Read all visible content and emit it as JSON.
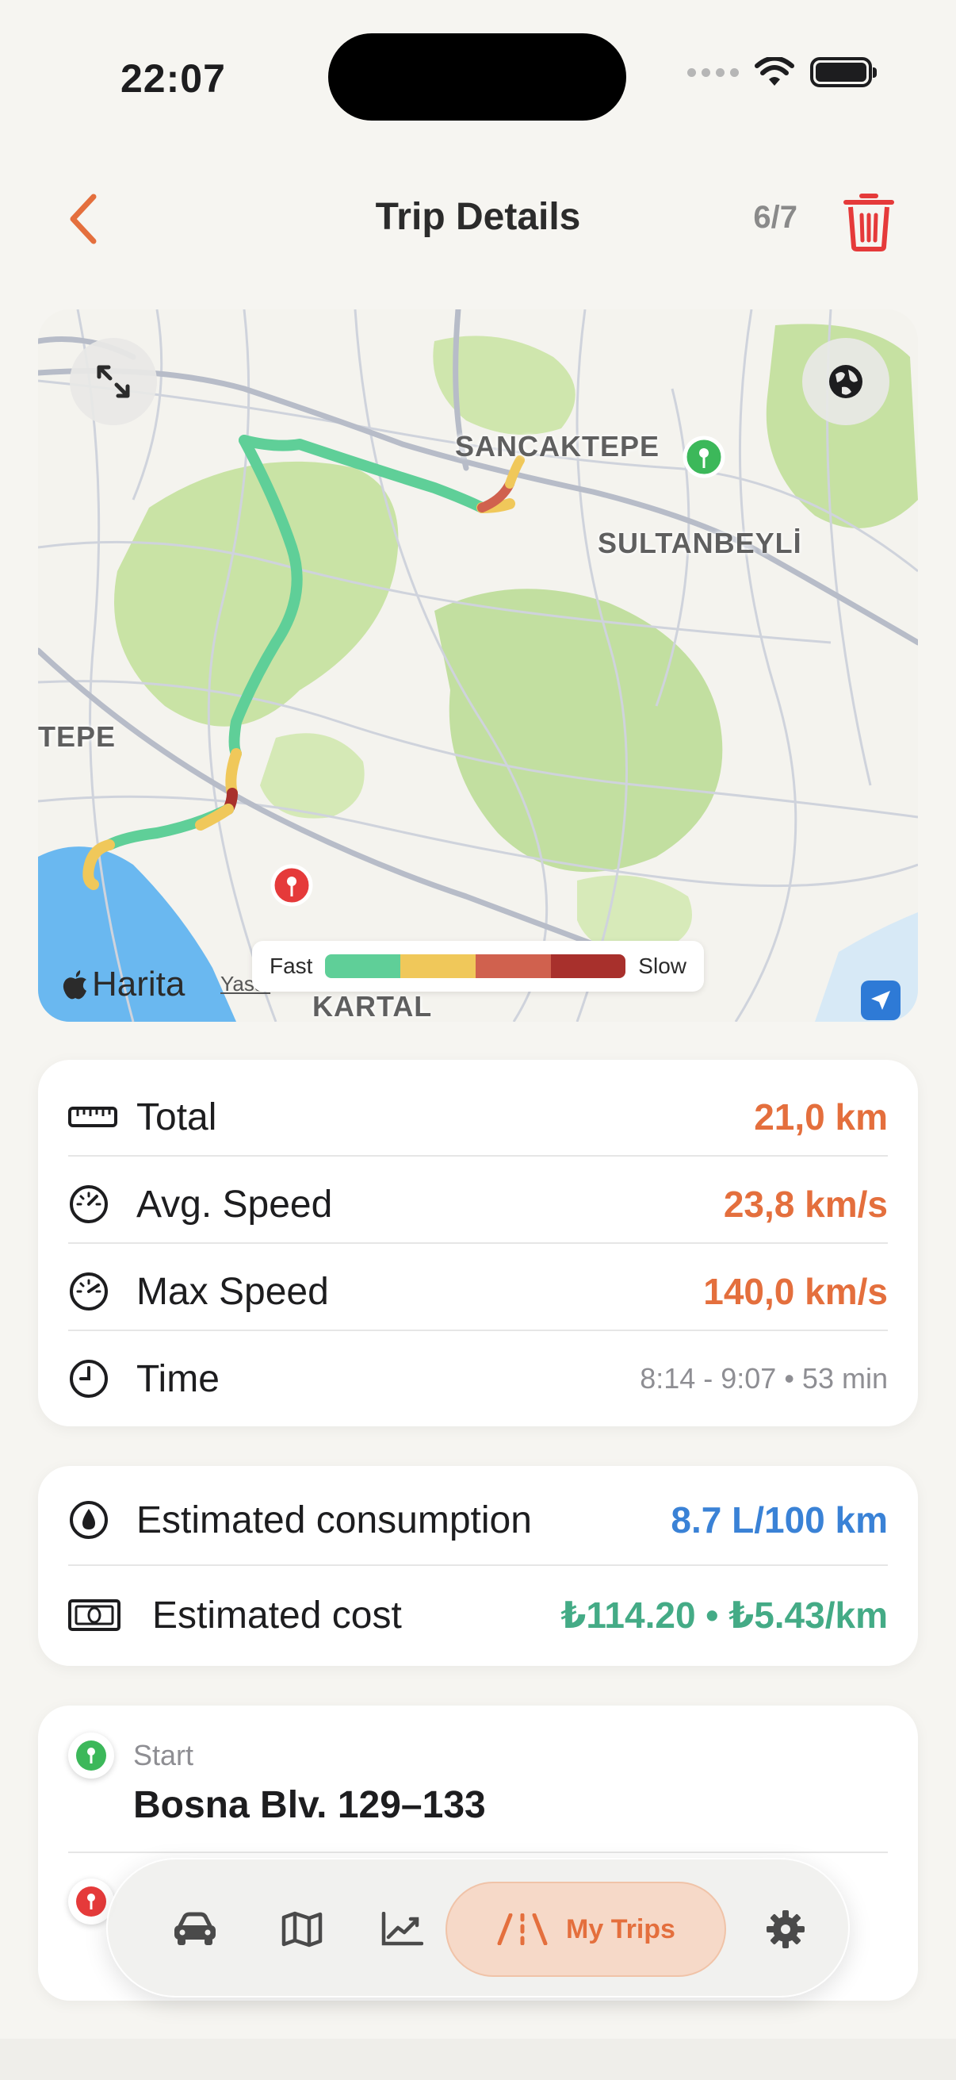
{
  "status_bar": {
    "time": "22:07"
  },
  "header": {
    "title": "Trip Details",
    "counter": "6/7"
  },
  "map": {
    "labels": {
      "sancaktepe": "SANCAKTEPE",
      "sultanbeyli": "SULTANBEYLİ",
      "tepe": "TEPE",
      "kartal": "KARTAL"
    },
    "attribution": "Harita",
    "legal": "Yasal",
    "legend": {
      "fast": "Fast",
      "slow": "Slow",
      "colors": [
        "#5fcf98",
        "#f0c85a",
        "#d0614e",
        "#a8302c"
      ]
    }
  },
  "stats": {
    "total": {
      "label": "Total",
      "value": "21,0 km"
    },
    "avg_speed": {
      "label": "Avg. Speed",
      "value": "23,8 km/s"
    },
    "max_speed": {
      "label": "Max Speed",
      "value": "140,0 km/s"
    },
    "time": {
      "label": "Time",
      "value": "8:14 - 9:07  •  53 min"
    }
  },
  "costs": {
    "consumption": {
      "label": "Estimated consumption",
      "value": "8.7 L/100 km"
    },
    "cost": {
      "label": "Estimated cost",
      "value": "₺114.20 • ₺5.43/km"
    }
  },
  "locations": {
    "start": {
      "caption": "Start",
      "address": "Bosna Blv. 129–133"
    }
  },
  "tabbar": {
    "active_label": "My Trips"
  },
  "colors": {
    "accent": "#e46f3d",
    "start_pin": "#3cb85a",
    "end_pin": "#e53a3a",
    "blue": "#3a82d6",
    "green": "#44ab86"
  }
}
